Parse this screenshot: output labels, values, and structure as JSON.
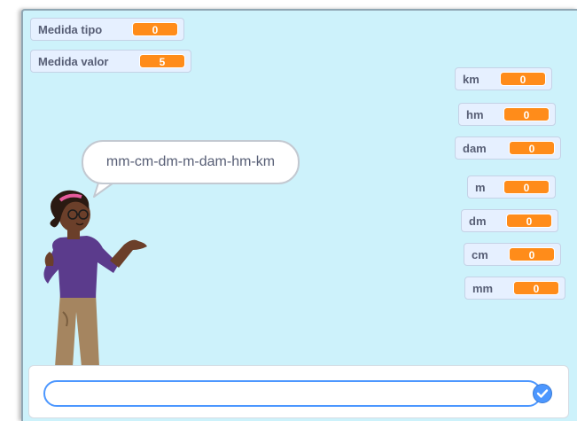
{
  "monitors": {
    "medida_tipo": {
      "label": "Medida tipo",
      "value": "0"
    },
    "medida_valor": {
      "label": "Medida valor",
      "value": "5"
    },
    "km": {
      "label": "km",
      "value": "0"
    },
    "hm": {
      "label": "hm",
      "value": "0"
    },
    "dam": {
      "label": "dam",
      "value": "0"
    },
    "m": {
      "label": "m",
      "value": "0"
    },
    "dm": {
      "label": "dm",
      "value": "0"
    },
    "cm": {
      "label": "cm",
      "value": "0"
    },
    "mm": {
      "label": "mm",
      "value": "0"
    }
  },
  "speech": {
    "text": "mm-cm-dm-m-dam-hm-km"
  },
  "ask": {
    "value": "",
    "placeholder": ""
  },
  "colors": {
    "stage_bg": "#cdf2fb",
    "monitor_value": "#ff8c1a",
    "accent": "#4c97ff"
  },
  "icons": {
    "submit": "check-icon"
  }
}
